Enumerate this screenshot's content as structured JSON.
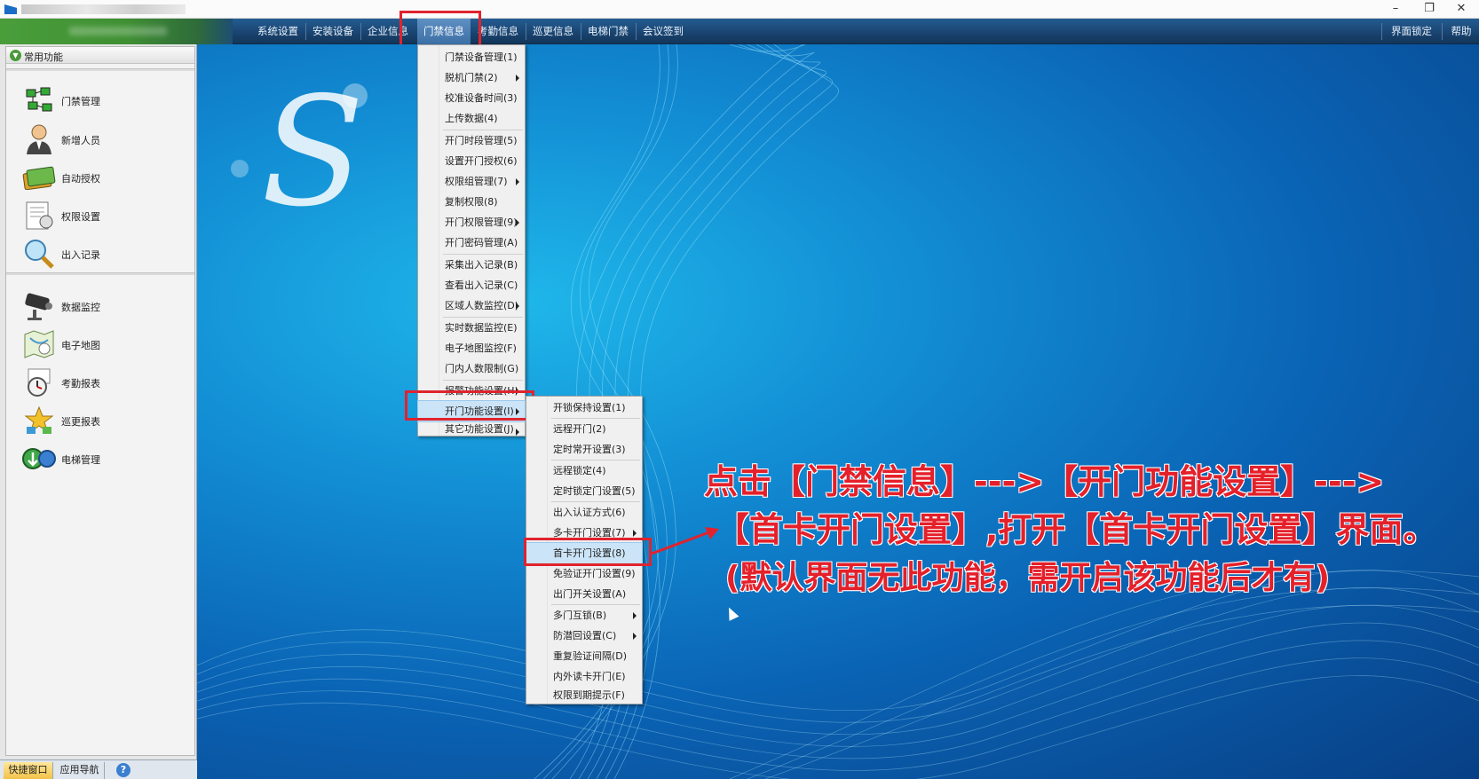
{
  "titlebar": {
    "minimize": "–",
    "restore": "❐",
    "close": "✕"
  },
  "menubar": {
    "items": [
      "系统设置",
      "安装设备",
      "企业信息",
      "门禁信息",
      "考勤信息",
      "巡更信息",
      "电梯门禁",
      "会议签到"
    ],
    "right": [
      "界面锁定",
      "帮助"
    ]
  },
  "sidebar": {
    "header": "常用功能",
    "items": [
      {
        "label": "门禁管理",
        "icon": "door-access-icon"
      },
      {
        "label": "新增人员",
        "icon": "person-add-icon"
      },
      {
        "label": "自动授权",
        "icon": "card-authorize-icon"
      },
      {
        "label": "权限设置",
        "icon": "permission-icon"
      },
      {
        "label": "出入记录",
        "icon": "search-record-icon"
      },
      {
        "label": "数据监控",
        "icon": "camera-monitor-icon"
      },
      {
        "label": "电子地图",
        "icon": "map-icon"
      },
      {
        "label": "考勤报表",
        "icon": "clock-report-icon"
      },
      {
        "label": "巡更报表",
        "icon": "patrol-report-icon"
      },
      {
        "label": "电梯管理",
        "icon": "elevator-icon"
      }
    ],
    "tabs": [
      "快捷窗口",
      "应用导航"
    ],
    "help": "?"
  },
  "main_menu": {
    "items": [
      {
        "label": "门禁设备管理(1)",
        "sub": false
      },
      {
        "label": "脱机门禁(2)",
        "sub": true
      },
      {
        "label": "校准设备时间(3)",
        "sub": false
      },
      {
        "label": "上传数据(4)",
        "sub": false
      },
      {
        "label": "开门时段管理(5)",
        "sub": false
      },
      {
        "label": "设置开门授权(6)",
        "sub": false
      },
      {
        "label": "权限组管理(7)",
        "sub": true
      },
      {
        "label": "复制权限(8)",
        "sub": false
      },
      {
        "label": "开门权限管理(9)",
        "sub": true
      },
      {
        "label": "开门密码管理(A)",
        "sub": false
      },
      {
        "label": "采集出入记录(B)",
        "sub": false
      },
      {
        "label": "查看出入记录(C)",
        "sub": false
      },
      {
        "label": "区域人数监控(D)",
        "sub": true
      },
      {
        "label": "实时数据监控(E)",
        "sub": false
      },
      {
        "label": "电子地图监控(F)",
        "sub": false
      },
      {
        "label": "门内人数限制(G)",
        "sub": false
      },
      {
        "label": "报警功能设置(H)",
        "sub": true
      },
      {
        "label": "开门功能设置(I)",
        "sub": true
      },
      {
        "label": "其它功能设置(J)",
        "sub": true
      }
    ]
  },
  "sub_menu": {
    "items": [
      {
        "label": "开锁保持设置(1)",
        "sub": false
      },
      {
        "label": "远程开门(2)",
        "sub": false
      },
      {
        "label": "定时常开设置(3)",
        "sub": false
      },
      {
        "label": "远程锁定(4)",
        "sub": false
      },
      {
        "label": "定时锁定门设置(5)",
        "sub": false
      },
      {
        "label": "出入认证方式(6)",
        "sub": false
      },
      {
        "label": "多卡开门设置(7)",
        "sub": true
      },
      {
        "label": "首卡开门设置(8)",
        "sub": false
      },
      {
        "label": "免验证开门设置(9)",
        "sub": false
      },
      {
        "label": "出门开关设置(A)",
        "sub": false
      },
      {
        "label": "多门互锁(B)",
        "sub": true
      },
      {
        "label": "防潜回设置(C)",
        "sub": true
      },
      {
        "label": "重复验证间隔(D)",
        "sub": false
      },
      {
        "label": "内外读卡开门(E)",
        "sub": false
      },
      {
        "label": "权限到期提示(F)",
        "sub": false
      }
    ]
  },
  "annotation": {
    "line1": "点击【门禁信息】--->【开门功能设置】--->",
    "line2": "【首卡开门设置】,打开【首卡开门设置】界面。",
    "line3": "(默认界面无此功能，需开启该功能后才有)"
  },
  "colors": {
    "accent": "#e0232e",
    "menubar": "#1b4a7a",
    "desktop": "#0a63b4"
  }
}
